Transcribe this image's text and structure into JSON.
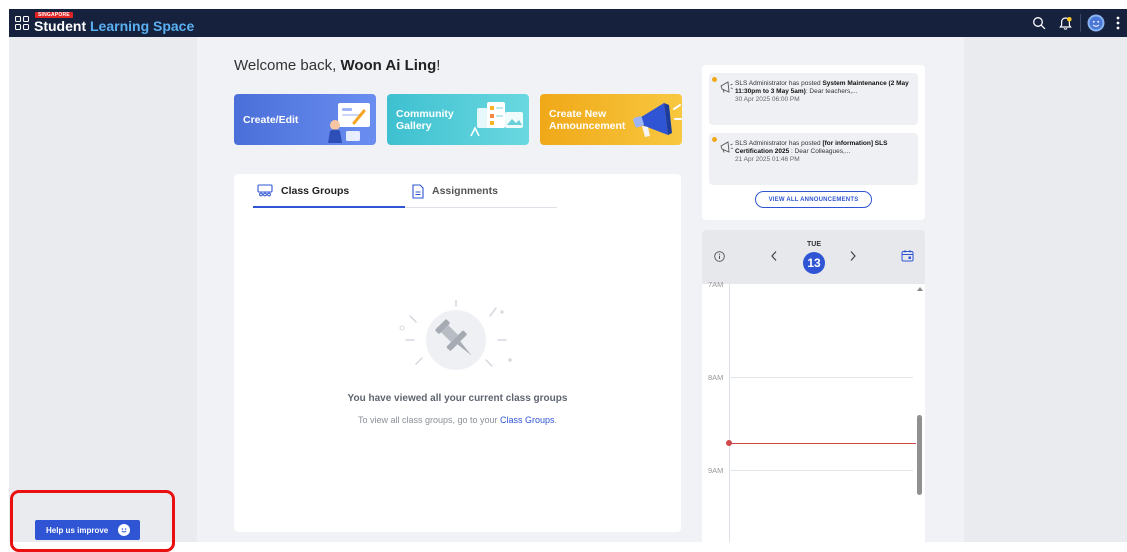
{
  "topbar": {
    "badge": "SINGAPORE",
    "brand_word1": "Student",
    "brand_word2": "Learning Space",
    "icons": [
      "grid-icon",
      "search-icon",
      "bell-icon",
      "avatar",
      "more-vertical-icon"
    ]
  },
  "welcome": {
    "prefix": "Welcome back, ",
    "name": "Woon Ai Ling",
    "suffix": "!"
  },
  "quick_actions": [
    {
      "label": "Create/Edit",
      "color": "#4a6fd8"
    },
    {
      "label": "Community Gallery",
      "color": "#3ec0d0"
    },
    {
      "label": "Create New Announcement",
      "color": "#f0a818"
    }
  ],
  "tabs": [
    {
      "label": "Class Groups",
      "active": true,
      "icon": "class-groups-icon"
    },
    {
      "label": "Assignments",
      "active": false,
      "icon": "document-icon"
    }
  ],
  "empty_state": {
    "title": "You have viewed all your current class groups",
    "sub_prefix": "To view all class groups, go to your ",
    "link": "Class Groups",
    "sub_suffix": "."
  },
  "announcements": {
    "items": [
      {
        "lead": "SLS Administrator has posted ",
        "bold": "System Maintenance (2 May 11:30pm to 3 May 5am)",
        "rest": ": Dear teachers,...",
        "date": "30 Apr 2025 06:00 PM"
      },
      {
        "lead": "SLS Administrator has posted ",
        "bold": "[for information] SLS Certification 2025",
        "rest": " : Dear Colleagues,...",
        "date": "21 Apr 2025 01:46 PM"
      }
    ],
    "view_all": "VIEW ALL ANNOUNCEMENTS"
  },
  "calendar": {
    "dow": "TUE",
    "day": "13",
    "times": [
      "7AM",
      "8AM",
      "9AM"
    ],
    "now_color": "#d04848"
  },
  "help": {
    "label": "Help us improve"
  },
  "colors": {
    "topbar": "#16213e",
    "accent": "#2f55d4",
    "highlight": "#e81010"
  }
}
